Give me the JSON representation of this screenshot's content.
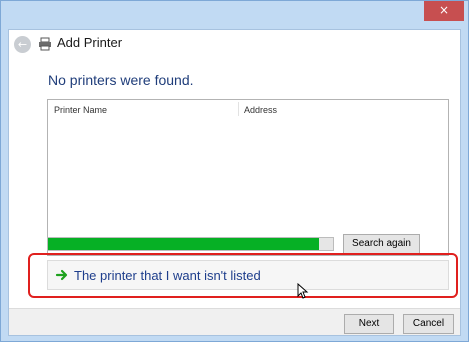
{
  "window": {
    "title": "Add Printer",
    "close_symbol": "×",
    "back_symbol": "←"
  },
  "content": {
    "heading": "No printers were found.",
    "columns": [
      "Printer Name",
      "Address"
    ],
    "progress_fraction": 0.95,
    "search_again_label": "Search again",
    "not_listed_label": "The printer that I want isn't listed"
  },
  "footer": {
    "next_label": "Next",
    "cancel_label": "Cancel"
  },
  "colors": {
    "close_button": "#c74f50",
    "progress": "#06b025",
    "link_text": "#1e3e8c",
    "highlight": "#e0201e"
  },
  "icons": [
    "close-icon",
    "back-arrow-icon",
    "printer-icon",
    "green-arrow-icon",
    "mouse-cursor-icon"
  ]
}
